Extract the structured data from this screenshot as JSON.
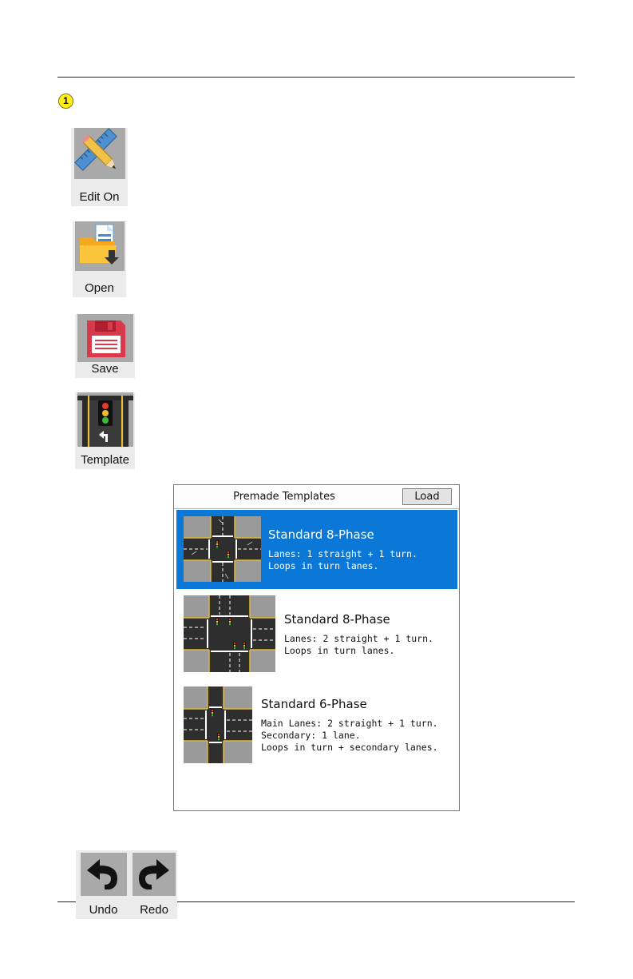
{
  "callout": {
    "number": "1"
  },
  "toolbar": {
    "edit_on": {
      "label": "Edit On",
      "icon": "pencil-ruler-icon"
    },
    "open": {
      "label": "Open",
      "icon": "folder-open-icon"
    },
    "save": {
      "label": "Save",
      "icon": "floppy-disk-icon"
    },
    "template": {
      "label": "Template",
      "icon": "traffic-light-template-icon"
    },
    "undo": {
      "label": "Undo",
      "icon": "undo-arrow-icon"
    },
    "redo": {
      "label": "Redo",
      "icon": "redo-arrow-icon"
    }
  },
  "dialog": {
    "title": "Premade Templates",
    "load_label": "Load",
    "selected_color": "#0b78d7",
    "templates": [
      {
        "title": "Standard 8-Phase",
        "line1": "Lanes: 1 straight + 1 turn.",
        "line2": "Loops in turn lanes.",
        "selected": true
      },
      {
        "title": "Standard 8-Phase",
        "line1": "Lanes: 2 straight + 1 turn.",
        "line2": "Loops in turn lanes.",
        "selected": false
      },
      {
        "title": "Standard 6-Phase",
        "line1": "Main Lanes: 2 straight + 1 turn.",
        "line2": "Secondary: 1 lane.",
        "line3": "Loops in turn + secondary lanes.",
        "selected": false
      }
    ]
  }
}
